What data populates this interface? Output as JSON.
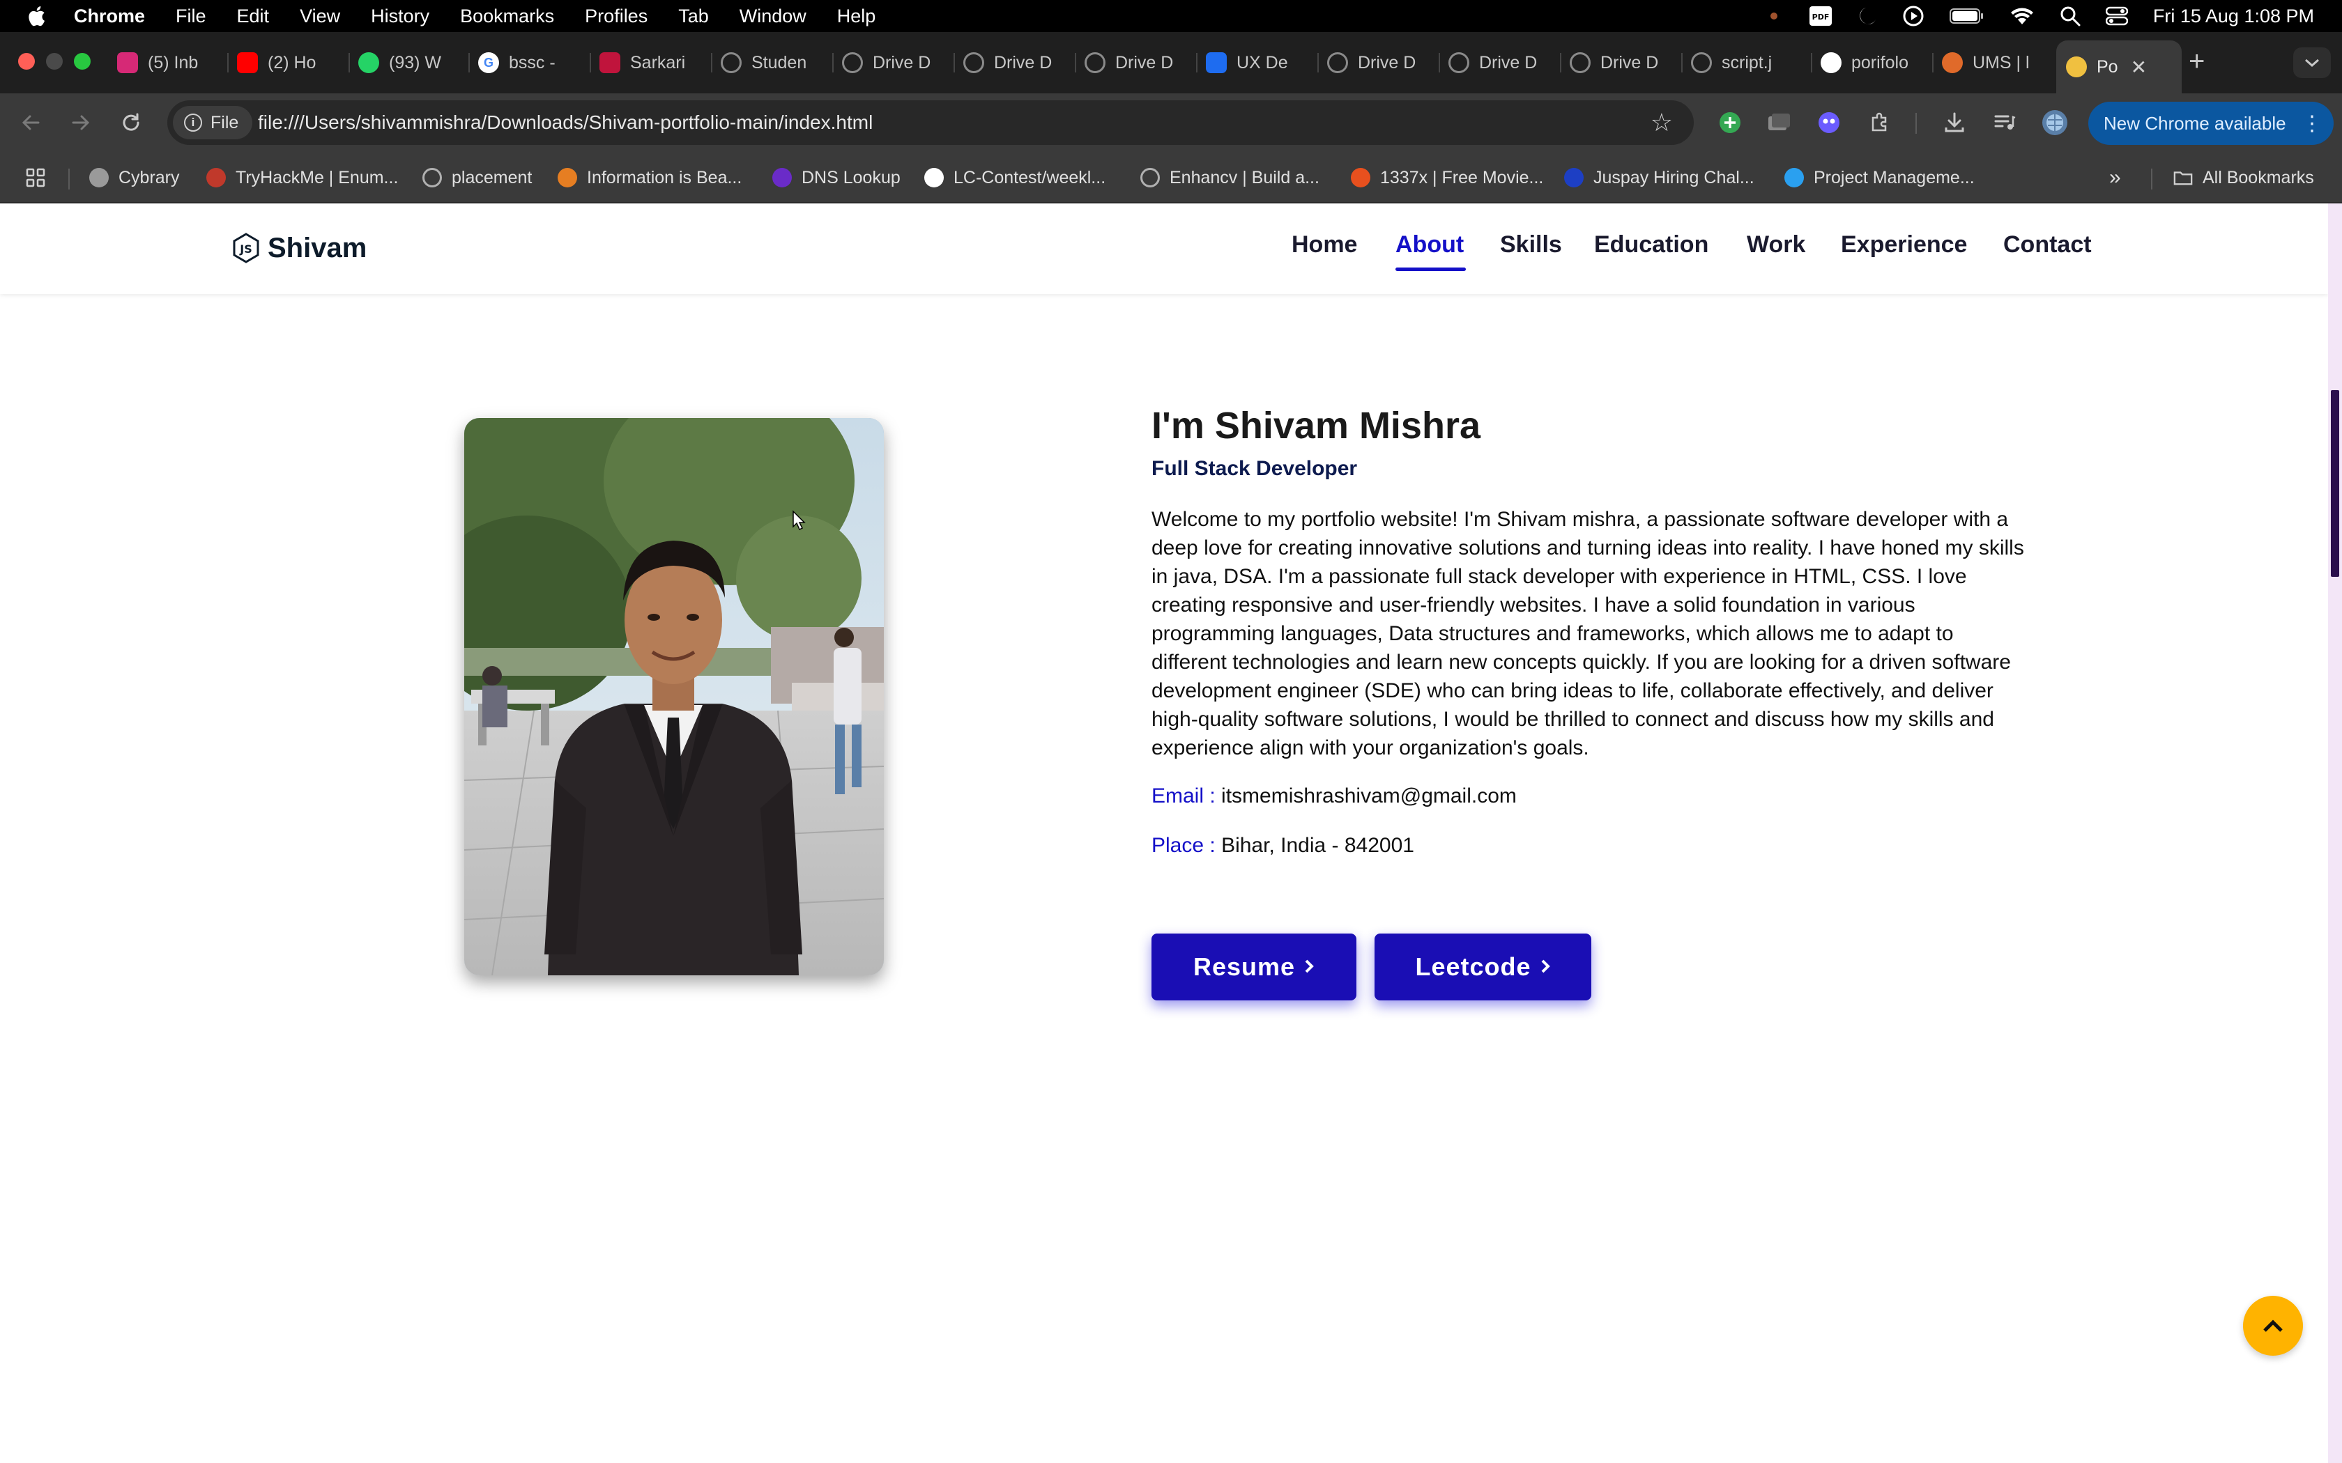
{
  "menubar": {
    "app": "Chrome",
    "items": [
      "File",
      "Edit",
      "View",
      "History",
      "Bookmarks",
      "Profiles",
      "Tab",
      "Window",
      "Help"
    ],
    "clock": "Fri 15 Aug  1:08 PM",
    "status_icons": [
      "pdf-icon",
      "moon-icon",
      "play-circle-icon",
      "battery-icon",
      "wifi-icon",
      "search-icon",
      "control-center-icon"
    ]
  },
  "tabs": [
    {
      "title": "(5) Inb",
      "icon": "instagram-icon",
      "color": "#d62976"
    },
    {
      "title": "(2) Ho",
      "icon": "youtube-icon",
      "color": "#ff0000"
    },
    {
      "title": "(93) W",
      "icon": "whatsapp-icon",
      "color": "#25d366"
    },
    {
      "title": "bssc -",
      "icon": "google-icon",
      "color": "#4285f4"
    },
    {
      "title": "Sarkari",
      "icon": "sarkari-icon",
      "color": "#c0143c"
    },
    {
      "title": "Studen",
      "icon": "globe-icon",
      "color": "#6a6a6a"
    },
    {
      "title": "Drive D",
      "icon": "globe-icon",
      "color": "#6a6a6a"
    },
    {
      "title": "Drive D",
      "icon": "globe-icon",
      "color": "#6a6a6a"
    },
    {
      "title": "Drive D",
      "icon": "globe-icon",
      "color": "#6a6a6a"
    },
    {
      "title": "UX De",
      "icon": "trello-icon",
      "color": "#1e6cf0"
    },
    {
      "title": "Drive D",
      "icon": "globe-icon",
      "color": "#6a6a6a"
    },
    {
      "title": "Drive D",
      "icon": "globe-icon",
      "color": "#6a6a6a"
    },
    {
      "title": "Drive D",
      "icon": "globe-icon",
      "color": "#6a6a6a"
    },
    {
      "title": "script.j",
      "icon": "globe-icon",
      "color": "#6a6a6a"
    },
    {
      "title": "porifolo",
      "icon": "github-icon",
      "color": "#ffffff"
    },
    {
      "title": "UMS | l",
      "icon": "ums-icon",
      "color": "#e06a2a"
    },
    {
      "title": "Po",
      "icon": "avatar-icon",
      "color": "#f0c040",
      "active": true
    }
  ],
  "toolbar": {
    "chip_label": "File",
    "url": "file:///Users/shivammishra/Downloads/Shivam-portfolio-main/index.html",
    "update_label": "New Chrome available"
  },
  "bookmarks": [
    {
      "label": "Cybrary",
      "icon": "cybrary-icon",
      "color": "#9a9a9a"
    },
    {
      "label": "TryHackMe | Enum...",
      "icon": "tryhackme-icon",
      "color": "#c0392b"
    },
    {
      "label": "placement",
      "icon": "globe-icon",
      "color": "#b0b0b0"
    },
    {
      "label": "Information is Bea...",
      "icon": "info-beautiful-icon",
      "color": "#e67e22"
    },
    {
      "label": "DNS Lookup",
      "icon": "dns-lookup-icon",
      "color": "#6a2bc8"
    },
    {
      "label": "LC-Contest/weekl...",
      "icon": "github-icon",
      "color": "#ffffff"
    },
    {
      "label": "Enhancv | Build a...",
      "icon": "globe-icon",
      "color": "#b0b0b0"
    },
    {
      "label": "1337x | Free Movie...",
      "icon": "1337x-icon",
      "color": "#e8501e"
    },
    {
      "label": "Juspay Hiring Chal...",
      "icon": "unstop-icon",
      "color": "#1d3fc4"
    },
    {
      "label": "Project Manageme...",
      "icon": "project-icon",
      "color": "#2aa0f0"
    }
  ],
  "all_bookmarks": "All Bookmarks",
  "site": {
    "logo": "Shivam",
    "nav": [
      "Home",
      "About",
      "Skills",
      "Education",
      "Work",
      "Experience",
      "Contact"
    ],
    "active_nav": "About",
    "accent": "#1410c8",
    "about": {
      "name": "I'm Shivam Mishra",
      "role": "Full Stack Developer",
      "bio": "Welcome to my portfolio website! I'm Shivam mishra, a passionate software developer with a deep love for creating innovative solutions and turning ideas into reality. I have honed my skills in java, DSA. I'm a passionate full stack developer with experience in HTML, CSS. I love creating responsive and user-friendly websites. I have a solid foundation in various programming languages, Data structures and frameworks, which allows me to adapt to different technologies and learn new concepts quickly. If you are looking for a driven software development engineer (SDE) who can bring ideas to life, collaborate effectively, and deliver high-quality software solutions, I would be thrilled to connect and discuss how my skills and experience align with your organization's goals.",
      "email_label": "Email :",
      "email": "itsmemishrashivam@gmail.com",
      "place_label": "Place :",
      "place": "Bihar, India - 842001",
      "buttons": [
        "Resume",
        "Leetcode"
      ],
      "button_color": "#1a0eb4"
    },
    "scroll_top_color": "#ffb300"
  }
}
